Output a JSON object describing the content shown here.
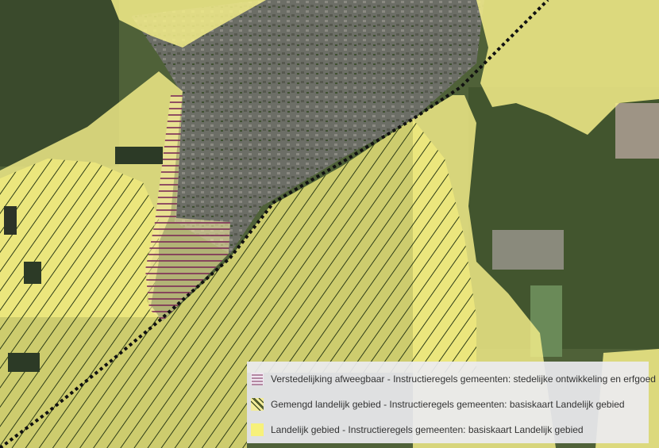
{
  "map": {
    "colors": {
      "landelijk": "#f5ef8a",
      "gemengd_hatch": "#2e3d16",
      "verstedelijking_hatch": "#7a2a55",
      "boundary": "#111111",
      "town": "#6f7168",
      "forest": "#3c4a2c",
      "fields": "#4f6138"
    }
  },
  "legend": {
    "items": [
      {
        "label": "Verstedelijking afweegbaar - Instructieregels gemeenten: stedelijke ontwikkeling en erfgoed",
        "swatch": "horizontal-lines-purple"
      },
      {
        "label": "Gemengd landelijk gebied - Instructieregels gemeenten: basiskaart Landelijk gebied",
        "swatch": "diagonal-lines-olive"
      },
      {
        "label": "Landelijk gebied - Instructieregels gemeenten: basiskaart Landelijk gebied",
        "swatch": "solid-yellow"
      }
    ]
  }
}
